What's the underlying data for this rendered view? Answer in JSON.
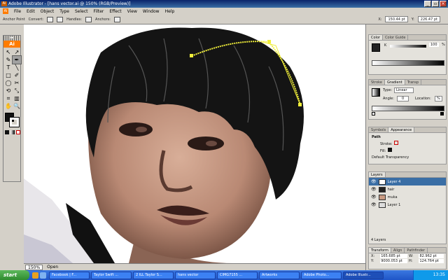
{
  "window": {
    "title": "Adobe Illustrator - [hans vector.ai @ 150% (RGB/Preview)]",
    "app_icon": "Ai"
  },
  "menu": [
    "File",
    "Edit",
    "Object",
    "Type",
    "Select",
    "Filter",
    "Effect",
    "View",
    "Window",
    "Help"
  ],
  "control_bar": {
    "selection": "Anchor Point",
    "convert": "Convert:",
    "handles": "Handles:",
    "anchors": "Anchors:",
    "x_label": "X:",
    "x_value": "150.44 pt",
    "y_label": "Y:",
    "y_value": "226.47 pt"
  },
  "tools_panel": {
    "logo": "Ai",
    "tools": [
      "↖",
      "↗",
      "✎",
      "✒",
      "T",
      "╲",
      "□",
      "✐",
      "◯",
      "✂",
      "⟲",
      "⤡",
      "⌗",
      "▥",
      "✋",
      "🔍"
    ]
  },
  "panels": {
    "color": {
      "tabs": [
        "Color",
        "Color Guide"
      ],
      "slider_label": "K",
      "slider_value": "100",
      "slider_unit": "%"
    },
    "gradient": {
      "tabs": [
        "Stroke",
        "Gradient",
        "Transp"
      ],
      "type_label": "Type:",
      "type_value": "Linear",
      "angle_label": "Angle:",
      "angle_value": "0",
      "location_label": "Location:",
      "location_value": "%"
    },
    "appearance": {
      "tabs": [
        "Symbols",
        "Appearance"
      ],
      "object": "Path",
      "stroke_label": "Stroke:",
      "fill_label": "Fill:",
      "default_transparency": "Default Transparency"
    },
    "layers": {
      "tabs": [
        "Layers"
      ],
      "items": [
        "Layer 4",
        "hair",
        "muka",
        "Layer 1"
      ],
      "footer": "4 Layers"
    },
    "transform": {
      "tabs": [
        "Transform",
        "Align",
        "Pathfinder"
      ],
      "x_label": "X:",
      "x_value": "165.685 pt",
      "y_label": "Y:",
      "y_value": "9000.053 pt",
      "w_label": "W:",
      "w_value": "82.962 pt",
      "h_label": "H:",
      "h_value": "124.764 pt",
      "angle_label": "⊿:",
      "angle_value": "0°"
    }
  },
  "status": {
    "zoom": "150%",
    "mode": "Open"
  },
  "taskbar": {
    "start": "start",
    "buttons": [
      "Facebook | F...",
      "Taylor Swift ...",
      "2 ILL Taylor S...",
      "hans vector",
      "CIMG7155 ...",
      "Artworks",
      "Adobe Photo...",
      "Adobe Illustr..."
    ],
    "clock": "13:35"
  },
  "colors": {
    "accent": "#ff7c00",
    "hair": "#141414",
    "skin": "#c89a82",
    "guide": "#f0ee3a"
  }
}
